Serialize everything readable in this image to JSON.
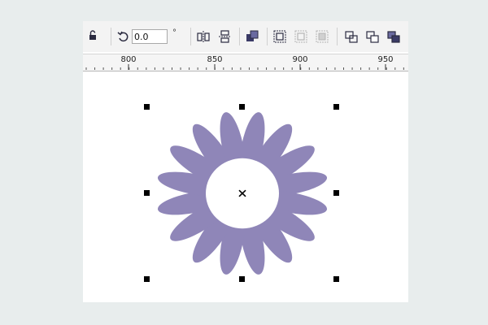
{
  "toolbar": {
    "lock_icon": "lock-icon",
    "rotate_icon": "rotate-icon",
    "angle_value": "0.0",
    "angle_unit": "°",
    "tools": [
      "mirror-horizontal-icon",
      "mirror-vertical-icon",
      "arrange-order-icon",
      "group-icon",
      "ungroup-icon",
      "ungroup-all-icon",
      "weld-icon",
      "trim-icon",
      "intersect-icon"
    ]
  },
  "ruler": {
    "labels": [
      "800",
      "850",
      "900",
      "950"
    ]
  },
  "canvas": {
    "shape": "flower",
    "petal_count": 16,
    "petal_color": "#8f86b8",
    "center_color": "#ffffff",
    "center_marker": "×"
  }
}
